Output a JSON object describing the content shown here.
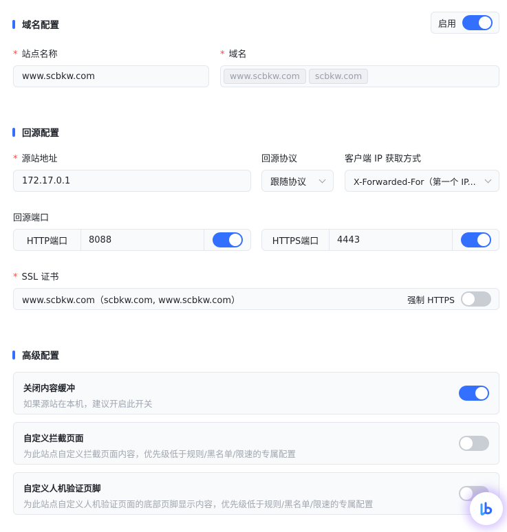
{
  "domain_section": {
    "title": "域名配置",
    "enable_label": "启用",
    "enabled": true,
    "site_name_label": "站点名称",
    "site_name_value": "www.scbkw.com",
    "domain_label": "域名",
    "domains": [
      "www.scbkw.com",
      "scbkw.com"
    ]
  },
  "origin_section": {
    "title": "回源配置",
    "origin_addr_label": "源站地址",
    "origin_addr_value": "172.17.0.1",
    "protocol_label": "回源协议",
    "protocol_value": "跟随协议",
    "client_ip_label": "客户端 IP 获取方式",
    "client_ip_value": "X-Forwarded-For（第一个 IP...",
    "port_label": "回源端口",
    "http_port_label": "HTTP端口",
    "http_port_value": "8088",
    "http_enabled": true,
    "https_port_label": "HTTPS端口",
    "https_port_value": "4443",
    "https_enabled": true,
    "ssl_label": "SSL 证书",
    "ssl_value": "www.scbkw.com（scbkw.com, www.scbkw.com）",
    "force_https_label": "强制 HTTPS",
    "force_https_enabled": false
  },
  "advanced_section": {
    "title": "高级配置",
    "items": [
      {
        "title": "关闭内容缓冲",
        "desc": "如果源站在本机，建议开启此开关",
        "enabled": true
      },
      {
        "title": "自定义拦截页面",
        "desc": "为此站点自定义拦截页面内容，优先级低于规则/黑名单/限速的专属配置",
        "enabled": false
      },
      {
        "title": "自定义人机验证页脚",
        "desc": "为此站点自定义人机验证页面的底部页脚显示内容，优先级低于规则/黑名单/限速的专属配置",
        "enabled": false
      }
    ]
  },
  "colors": {
    "accent": "#3370ff",
    "required": "#f54a45",
    "switch_off": "#c9cdd4"
  },
  "icons": {
    "assistant": "assistant-logo-icon",
    "dropdown": "chevron-down-icon"
  }
}
